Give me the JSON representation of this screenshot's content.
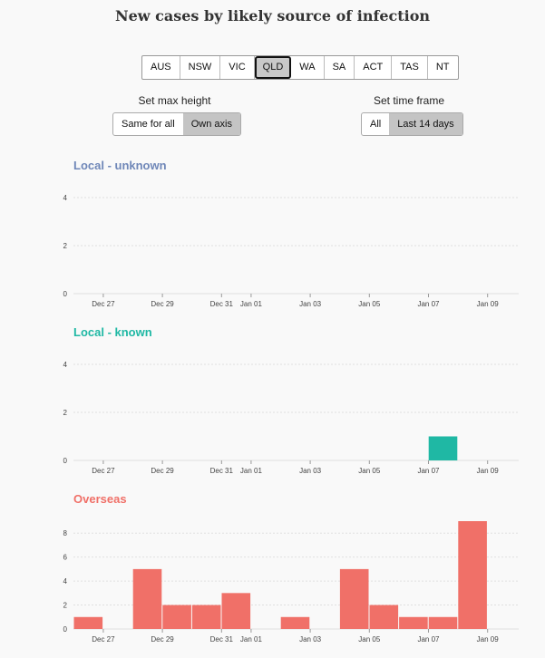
{
  "title": "New cases by likely source of infection",
  "states": [
    "AUS",
    "NSW",
    "VIC",
    "QLD",
    "WA",
    "SA",
    "ACT",
    "TAS",
    "NT"
  ],
  "selected_state": "QLD",
  "controls": {
    "max_height_label": "Set max height",
    "max_height_options": [
      "Same for all",
      "Own axis"
    ],
    "max_height_selected": "Own axis",
    "time_frame_label": "Set time frame",
    "time_frame_options": [
      "All",
      "Last 14 days"
    ],
    "time_frame_selected": "Last 14 days"
  },
  "chart_data": [
    {
      "type": "bar",
      "title": "Local - unknown",
      "color": "#6f87b8",
      "categories": [
        "Dec 26",
        "Dec 27",
        "Dec 28",
        "Dec 29",
        "Dec 30",
        "Dec 31",
        "Jan 01",
        "Jan 02",
        "Jan 03",
        "Jan 04",
        "Jan 05",
        "Jan 06",
        "Jan 07",
        "Jan 08"
      ],
      "values": [
        0,
        0,
        0,
        0,
        0,
        0,
        0,
        0,
        0,
        0,
        0,
        0,
        0,
        0
      ],
      "x_tick_labels": [
        "Dec 27",
        "Dec 29",
        "Dec 31",
        "Jan 01",
        "Jan 03",
        "Jan 05",
        "Jan 07",
        "Jan 09"
      ],
      "y_ticks": [
        0,
        2,
        4
      ],
      "ylim": [
        0,
        4
      ],
      "grid": true
    },
    {
      "type": "bar",
      "title": "Local - known",
      "color": "#1fb8a4",
      "categories": [
        "Dec 26",
        "Dec 27",
        "Dec 28",
        "Dec 29",
        "Dec 30",
        "Dec 31",
        "Jan 01",
        "Jan 02",
        "Jan 03",
        "Jan 04",
        "Jan 05",
        "Jan 06",
        "Jan 07",
        "Jan 08"
      ],
      "values": [
        0,
        0,
        0,
        0,
        0,
        0,
        0,
        0,
        0,
        0,
        0,
        0,
        1,
        0
      ],
      "x_tick_labels": [
        "Dec 27",
        "Dec 29",
        "Dec 31",
        "Jan 01",
        "Jan 03",
        "Jan 05",
        "Jan 07",
        "Jan 09"
      ],
      "y_ticks": [
        0,
        2,
        4
      ],
      "ylim": [
        0,
        4
      ],
      "grid": true
    },
    {
      "type": "bar",
      "title": "Overseas",
      "color": "#f07068",
      "categories": [
        "Dec 26",
        "Dec 27",
        "Dec 28",
        "Dec 29",
        "Dec 30",
        "Dec 31",
        "Jan 01",
        "Jan 02",
        "Jan 03",
        "Jan 04",
        "Jan 05",
        "Jan 06",
        "Jan 07",
        "Jan 08"
      ],
      "values": [
        1,
        0,
        5,
        2,
        2,
        3,
        0,
        1,
        0,
        5,
        2,
        1,
        1,
        9
      ],
      "x_tick_labels": [
        "Dec 27",
        "Dec 29",
        "Dec 31",
        "Jan 01",
        "Jan 03",
        "Jan 05",
        "Jan 07",
        "Jan 09"
      ],
      "y_ticks": [
        0,
        2,
        4,
        6,
        8
      ],
      "ylim": [
        0,
        9
      ],
      "grid": true
    }
  ]
}
